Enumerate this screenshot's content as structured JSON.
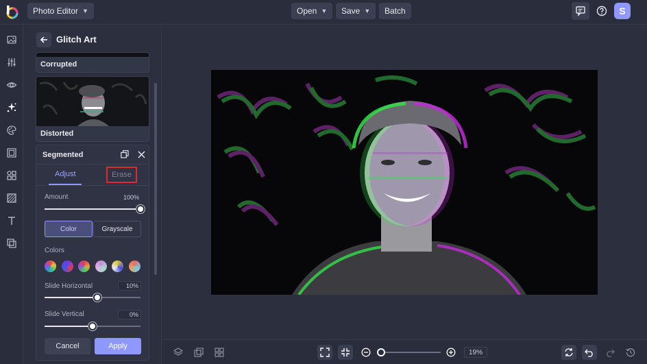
{
  "topbar": {
    "app_menu": "Photo Editor",
    "open_label": "Open",
    "save_label": "Save",
    "batch_label": "Batch",
    "avatar_initial": "S"
  },
  "rail": {
    "icons": [
      "image-icon",
      "sliders-icon",
      "eye-icon",
      "effects-icon",
      "palette-icon",
      "frame-icon",
      "graphics-icon",
      "texture-icon",
      "text-icon",
      "overlay-icon"
    ],
    "active": "effects-icon"
  },
  "panel": {
    "title": "Glitch Art",
    "thumbs": [
      {
        "label": "Corrupted"
      },
      {
        "label": "Distorted"
      }
    ],
    "segmented": {
      "title": "Segmented",
      "tabs": {
        "adjust": "Adjust",
        "erase": "Erase"
      },
      "amount": {
        "label": "Amount",
        "value": "100%",
        "fraction": 1.0
      },
      "modes": {
        "color": "Color",
        "grayscale": "Grayscale",
        "selected": "Color"
      },
      "colors_label": "Colors",
      "swatches": [
        "#e04a4a",
        "#6a3df0",
        "#e0395a",
        "#c78bd9",
        "#d9c63a",
        "#e86a6a"
      ],
      "slide_horizontal": {
        "label": "Slide Horizontal",
        "value": "10%",
        "fraction": 0.55
      },
      "slide_vertical": {
        "label": "Slide Vertical",
        "value": "0%",
        "fraction": 0.5
      },
      "cancel_label": "Cancel",
      "apply_label": "Apply"
    }
  },
  "bottombar": {
    "zoom_value": "19%",
    "zoom_fraction": 0.0
  },
  "colors": {
    "accent": "#8f98ff",
    "highlight": "#e02a2a",
    "glitch_magenta": "#c02bd6",
    "glitch_green": "#35e04a"
  }
}
